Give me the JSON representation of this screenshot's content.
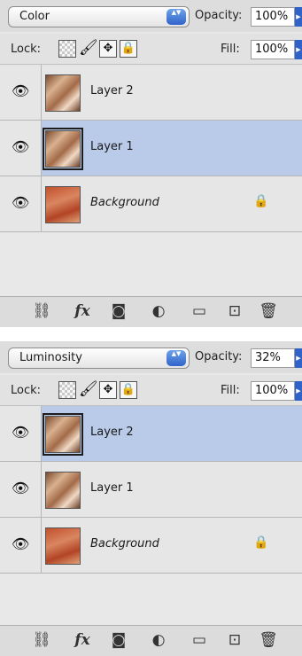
{
  "panels": [
    {
      "blend_mode": "Color",
      "opacity_label": "Opacity:",
      "opacity_value": "100%",
      "lock_label": "Lock:",
      "fill_label": "Fill:",
      "fill_value": "100%",
      "layers": [
        {
          "name": "Layer 2",
          "selected": false,
          "visible": true,
          "locked": false
        },
        {
          "name": "Layer 1",
          "selected": true,
          "visible": true,
          "locked": false
        },
        {
          "name": "Background",
          "selected": false,
          "visible": true,
          "locked": true
        }
      ]
    },
    {
      "blend_mode": "Luminosity",
      "opacity_label": "Opacity:",
      "opacity_value": "32%",
      "lock_label": "Lock:",
      "fill_label": "Fill:",
      "fill_value": "100%",
      "layers": [
        {
          "name": "Layer 2",
          "selected": true,
          "visible": true,
          "locked": false
        },
        {
          "name": "Layer 1",
          "selected": false,
          "visible": true,
          "locked": false
        },
        {
          "name": "Background",
          "selected": false,
          "visible": true,
          "locked": true
        }
      ]
    }
  ],
  "icons": {
    "eye": "👁",
    "lock_layer": "🔒",
    "stepper": "▲▼",
    "slider_arrow": "▶",
    "lock_paint": "🖌",
    "lock_move": "✥",
    "lock_all": "🔒",
    "link": "⛓",
    "fx": "fx",
    "mask": "◙",
    "adjustment": "◐",
    "group": "▭",
    "new_layer": "⊡",
    "trash": "🗑"
  },
  "colors": {
    "selected_row": "#b9cbe9",
    "panel_bg": "#e8e8e8",
    "accent_blue": "#2f63c9"
  }
}
